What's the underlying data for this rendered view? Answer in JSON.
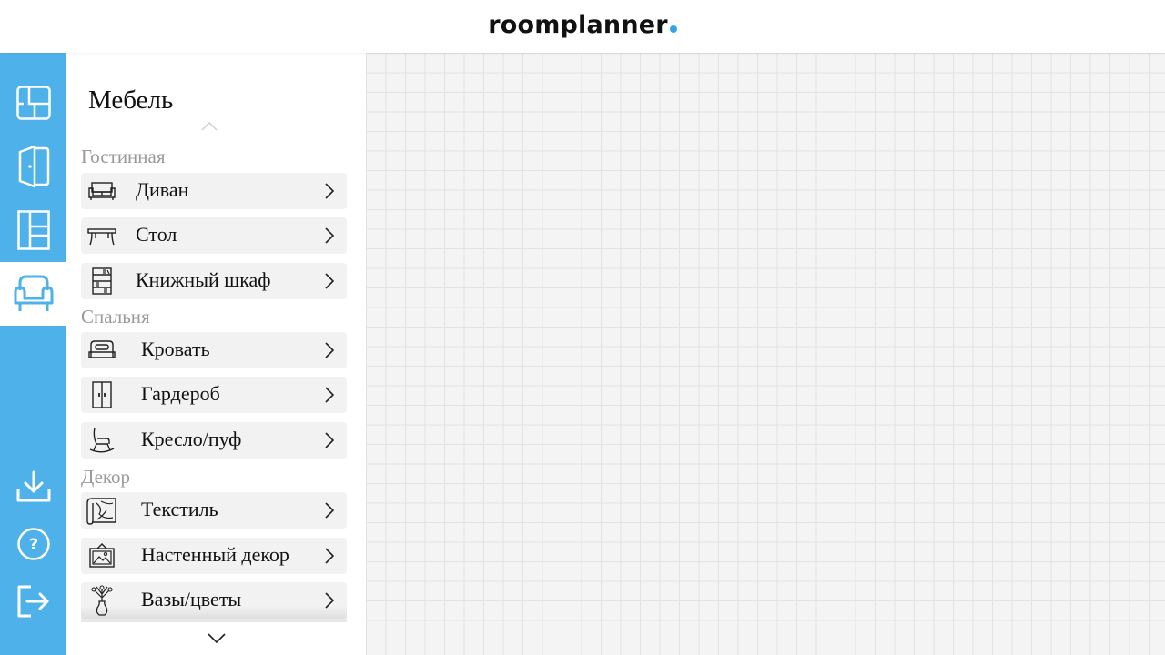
{
  "header": {
    "logo_text": "roomplanner",
    "accent_color": "#34a5e4"
  },
  "rail": {
    "background": "#4fb1ea",
    "buttons": [
      {
        "icon": "floor-plan-icon",
        "active": false
      },
      {
        "icon": "door-icon",
        "active": false
      },
      {
        "icon": "window-icon",
        "active": false
      },
      {
        "icon": "armchair-icon",
        "active": true
      },
      {
        "icon": "download-icon",
        "active": false
      },
      {
        "icon": "help-icon",
        "active": false
      },
      {
        "icon": "logout-icon",
        "active": false
      }
    ]
  },
  "panel": {
    "title": "Мебель",
    "sections": [
      {
        "title": "Гостинная",
        "items": [
          {
            "label": "Диван",
            "icon": "sofa-icon"
          },
          {
            "label": "Стол",
            "icon": "table-icon"
          },
          {
            "label": "Книжный шкаф",
            "icon": "bookcase-icon"
          }
        ]
      },
      {
        "title": "Спальня",
        "items": [
          {
            "label": "Кровать",
            "icon": "bed-icon"
          },
          {
            "label": "Гардероб",
            "icon": "wardrobe-icon"
          },
          {
            "label": "Кресло/пуф",
            "icon": "rocking-chair-icon"
          }
        ]
      },
      {
        "title": "Декор",
        "items": [
          {
            "label": "Текстиль",
            "icon": "rug-icon"
          },
          {
            "label": "Настенный декор",
            "icon": "picture-frame-icon"
          },
          {
            "label": "Вазы/цветы",
            "icon": "vase-icon"
          }
        ]
      }
    ]
  }
}
